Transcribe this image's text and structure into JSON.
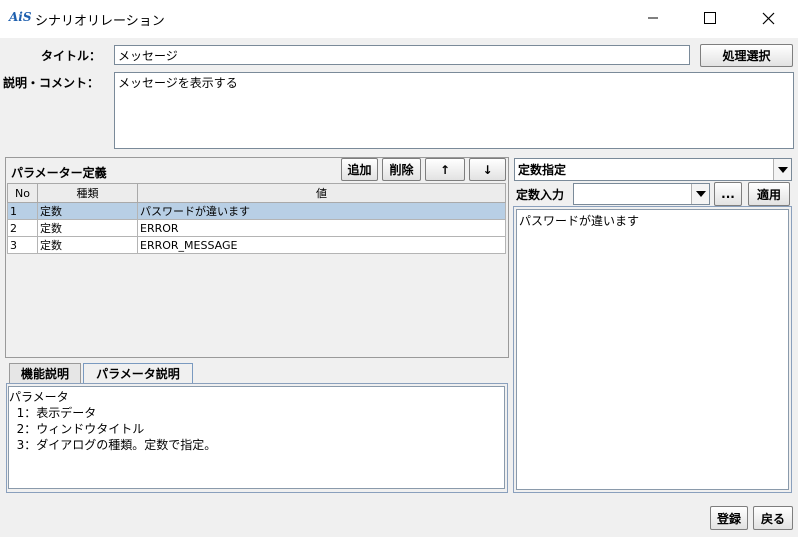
{
  "window": {
    "icon_text": "AiS",
    "title": "シナリオリレーション"
  },
  "form": {
    "title_label": "タイトル：",
    "title_value": "メッセージ",
    "process_select_button": "処理選択",
    "comment_label": "説明・コメント：",
    "comment_value": "メッセージを表示する"
  },
  "params": {
    "header": "パラメーター定義",
    "add_button": "追加",
    "delete_button": "削除",
    "up_button": "↑",
    "down_button": "↓",
    "columns": [
      "No",
      "種類",
      "値"
    ],
    "rows": [
      {
        "no": "1",
        "type": "定数",
        "value": "パスワードが違います"
      },
      {
        "no": "2",
        "type": "定数",
        "value": "ERROR"
      },
      {
        "no": "3",
        "type": "定数",
        "value": "ERROR_MESSAGE"
      }
    ]
  },
  "tabs": {
    "function_desc": "機能説明",
    "param_desc": "パラメータ説明"
  },
  "param_description": {
    "lines": [
      "パラメータ",
      "  1：表示データ",
      "  2：ウィンドウタイトル",
      "  3：ダイアログの種類。定数で指定。"
    ]
  },
  "constant": {
    "mode_select": "定数指定",
    "input_label": "定数入力",
    "input_value": "",
    "browse_button": "...",
    "apply_button": "適用",
    "text_value": "パスワードが違います"
  },
  "footer": {
    "register_button": "登録",
    "back_button": "戻る"
  }
}
